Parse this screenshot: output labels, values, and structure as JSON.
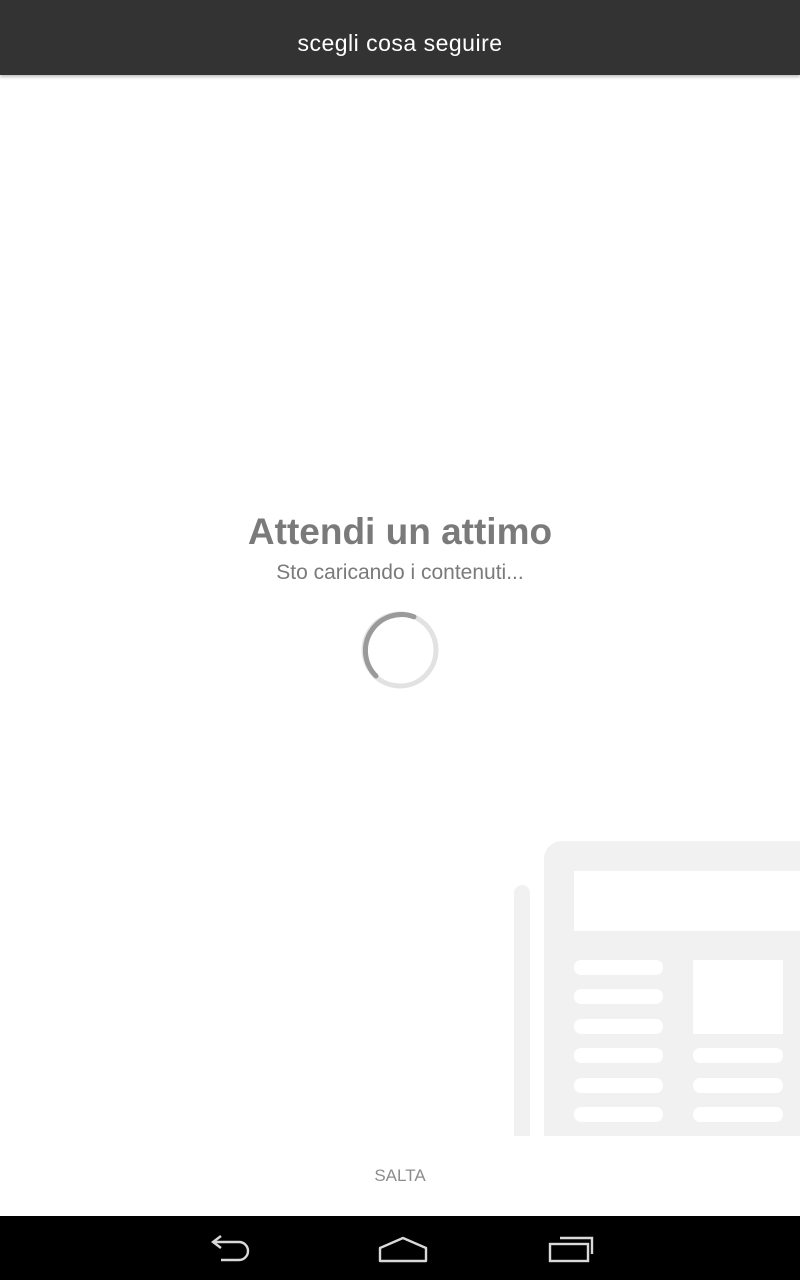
{
  "app_bar": {
    "title": "scegli cosa seguire",
    "background": "#333333"
  },
  "loading": {
    "title": "Attendi un attimo",
    "subtitle": "Sto caricando i contenuti...",
    "text_color": "#7a7a7a"
  },
  "illustration": {
    "icon": "newspaper-icon"
  },
  "footer": {
    "skip_label": "SALTA"
  },
  "nav_bar": {
    "buttons": [
      "back-icon",
      "home-icon",
      "recent-apps-icon"
    ]
  }
}
